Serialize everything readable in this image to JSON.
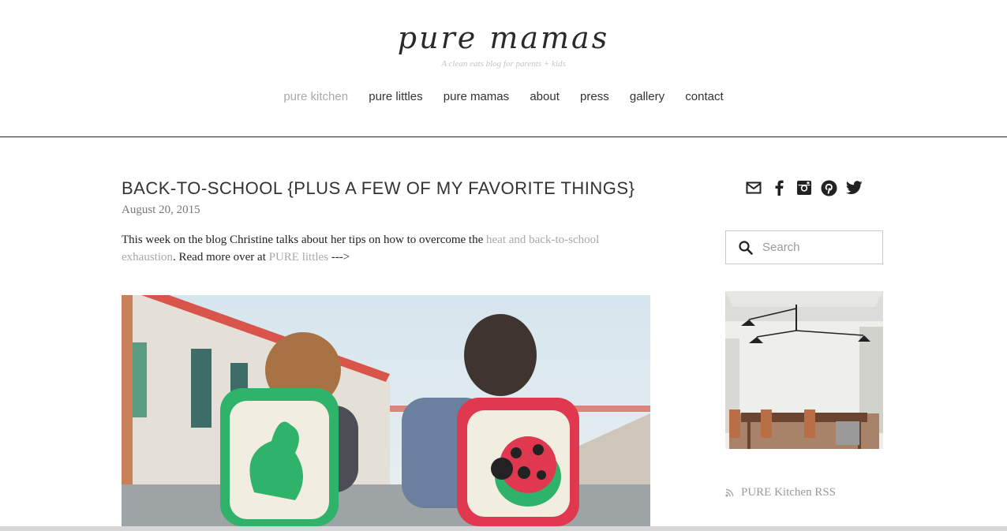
{
  "header": {
    "logo_text": "pure mamas",
    "tagline": "A clean eats blog for parents + kids"
  },
  "nav": {
    "items": [
      {
        "label": "pure kitchen",
        "active": true
      },
      {
        "label": "pure littles"
      },
      {
        "label": "pure mamas"
      },
      {
        "label": "about"
      },
      {
        "label": "press"
      },
      {
        "label": "gallery"
      },
      {
        "label": "contact"
      }
    ]
  },
  "post": {
    "title": "BACK-TO-SCHOOL {PLUS A FEW OF MY FAVORITE THINGS}",
    "date": "August 20, 2015",
    "body_intro": "This week on the blog Christine talks about her tips on how to overcome the ",
    "link1_text": "heat and back-to-school exhaustion",
    "body_mid": ". Read more over at ",
    "link2_text": "PURE littles",
    "body_end": " --->"
  },
  "sidebar": {
    "social_icons": [
      "email-icon",
      "facebook-icon",
      "instagram-icon",
      "pinterest-icon",
      "twitter-icon"
    ],
    "search_placeholder": "Search",
    "rss_label": "PURE Kitchen RSS"
  },
  "colors": {
    "nav_active": "#a9a9a9",
    "link": "#a8a8a8",
    "backpack_green": "#2fb36a",
    "backpack_red": "#e0384f"
  }
}
